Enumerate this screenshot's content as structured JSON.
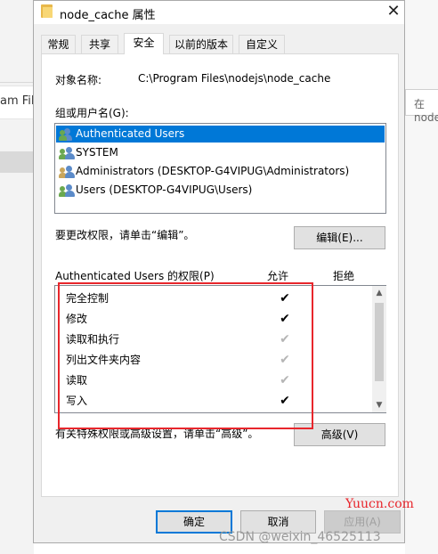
{
  "background": {
    "left_fragment_text": "am File",
    "right_fragment_text": "在 node_"
  },
  "dialog": {
    "title": "node_cache 属性",
    "close_glyph": "✕",
    "tabs": [
      {
        "label": "常规",
        "active": false
      },
      {
        "label": "共享",
        "active": false
      },
      {
        "label": "安全",
        "active": true
      },
      {
        "label": "以前的版本",
        "active": false
      },
      {
        "label": "自定义",
        "active": false
      }
    ],
    "object_name_label": "对象名称:",
    "object_name_value": "C:\\Program Files\\nodejs\\node_cache",
    "group_users_label": "组或用户名(G):",
    "users": [
      {
        "name": "Authenticated Users",
        "selected": true,
        "icon": "users-group-icon"
      },
      {
        "name": "SYSTEM",
        "selected": false,
        "icon": "user-group-icon"
      },
      {
        "name": "Administrators (DESKTOP-G4VIPUG\\Administrators)",
        "selected": false,
        "icon": "user-group-icon"
      },
      {
        "name": "Users (DESKTOP-G4VIPUG\\Users)",
        "selected": false,
        "icon": "user-group-icon"
      }
    ],
    "change_perm_hint": "要更改权限，请单击“编辑”。",
    "edit_button": "编辑(E)...",
    "perm_header": "Authenticated Users 的权限(P)",
    "allow_header": "允许",
    "deny_header": "拒绝",
    "permissions": [
      {
        "name": "完全控制",
        "allow": "✔",
        "state": "on"
      },
      {
        "name": "修改",
        "allow": "✔",
        "state": "on"
      },
      {
        "name": "读取和执行",
        "allow": "✔",
        "state": "grey"
      },
      {
        "name": "列出文件夹内容",
        "allow": "✔",
        "state": "grey"
      },
      {
        "name": "读取",
        "allow": "✔",
        "state": "grey"
      },
      {
        "name": "写入",
        "allow": "✔",
        "state": "on"
      }
    ],
    "scroll_up": "▲",
    "scroll_down": "▼",
    "advanced_hint": "有关特殊权限或高级设置，请单击“高级”。",
    "advanced_button": "高级(V)",
    "ok_button": "确定",
    "cancel_button": "取消",
    "apply_button": "应用(A)"
  },
  "watermarks": {
    "site": "Yuucn.com",
    "credit": "CSDN @weixin_46525113"
  },
  "colors": {
    "selection": "#0078d7",
    "highlight_box": "#e8262c"
  }
}
